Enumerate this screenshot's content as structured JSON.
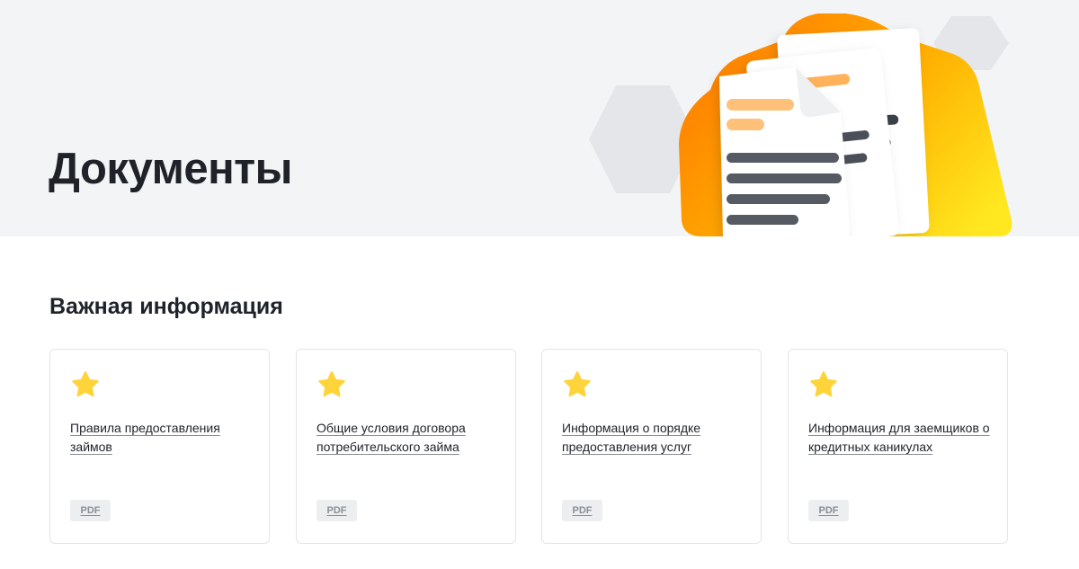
{
  "hero": {
    "title": "Документы",
    "illustration": "documents-illustration",
    "colors": {
      "background": "#f3f4f6",
      "folder_from": "#ff7a00",
      "folder_to": "#ffe31a"
    }
  },
  "section": {
    "title": "Важная информация"
  },
  "cards": [
    {
      "icon": "star-icon",
      "title": "Правила предоставления займов",
      "badge": "PDF"
    },
    {
      "icon": "star-icon",
      "title": "Общие условия договора потребительского займа",
      "badge": "PDF"
    },
    {
      "icon": "star-icon",
      "title": "Информация о порядке предоставления услуг",
      "badge": "PDF"
    },
    {
      "icon": "star-icon",
      "title": "Информация для заемщиков о кредитных каникулах",
      "badge": "PDF"
    }
  ],
  "colors": {
    "accent_star": "#ffd43b",
    "text": "#1f2329",
    "card_border": "#e3e5e8"
  }
}
